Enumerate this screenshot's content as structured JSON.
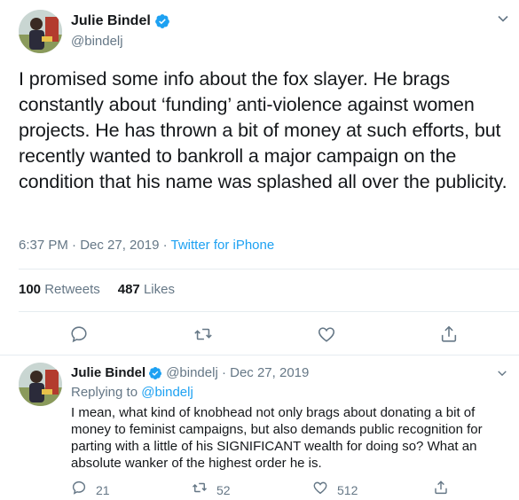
{
  "tweet": {
    "author_name": "Julie Bindel",
    "author_handle": "@bindelj",
    "text": "I promised some info about the fox slayer. He brags constantly about ‘funding’ anti-violence against women projects. He has thrown a bit of money at such efforts, but recently wanted to bankroll a major campaign on the condition that his name was splashed all over the publicity.",
    "time": "6:37 PM · Dec 27, 2019 · ",
    "source": "Twitter for iPhone",
    "retweets_count": "100",
    "retweets_label": "Retweets",
    "likes_count": "487",
    "likes_label": "Likes"
  },
  "reply": {
    "author_name": "Julie Bindel",
    "author_handle": "@bindelj",
    "date": "· Dec 27, 2019",
    "replying_prefix": "Replying to ",
    "replying_handle": "@bindelj",
    "text": "I mean, what kind of knobhead not only brags about donating a bit of money to feminist campaigns, but also demands public recognition for parting with a little of his SIGNIFICANT wealth for doing so? What an absolute wanker of the highest order he is.",
    "reply_count": "21",
    "retweet_count": "52",
    "like_count": "512"
  },
  "icons": {
    "verified": "verified-badge-icon",
    "caret": "chevron-down-icon",
    "reply": "reply-icon",
    "retweet": "retweet-icon",
    "like": "heart-icon",
    "share": "share-icon"
  },
  "colors": {
    "accent": "#1da1f2",
    "secondary_text": "#657786",
    "divider": "#e6ecf0"
  }
}
